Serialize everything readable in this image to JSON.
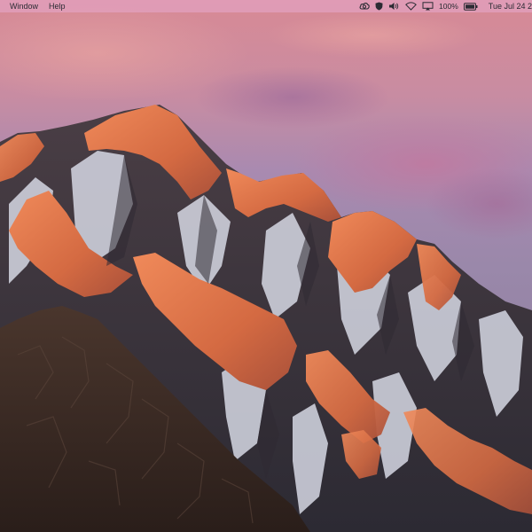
{
  "menubar": {
    "items": [
      {
        "label": "Window"
      },
      {
        "label": "Help"
      }
    ],
    "status": {
      "icons": [
        "creative-cloud-icon",
        "shield-icon",
        "volume-icon",
        "wifi-icon",
        "airplay-icon",
        "battery-icon"
      ],
      "battery_percent": "100%",
      "clock": "Tue Jul 24  2"
    }
  },
  "wallpaper": {
    "name": "macOS Sierra mountain",
    "colors": {
      "sky_top": "#d98a96",
      "sky_mid": "#a78bb0",
      "cloud": "#b07ea8",
      "rock_lit": "#d8704a",
      "rock_shadow": "#3a3236",
      "snow": "#d9dbe6",
      "foreground_rock": "#3d2c26"
    }
  }
}
